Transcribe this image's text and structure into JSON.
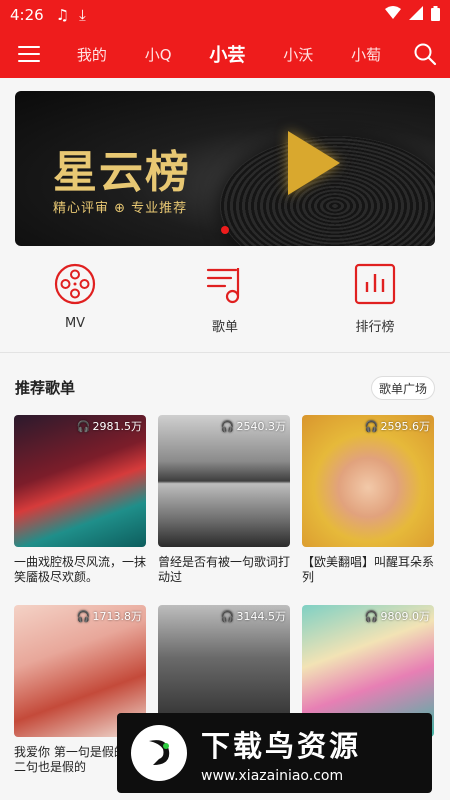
{
  "status": {
    "time": "4:26"
  },
  "nav": {
    "tabs": [
      {
        "label": "我的"
      },
      {
        "label": "小Q"
      },
      {
        "label": "小芸"
      },
      {
        "label": "小沃"
      },
      {
        "label": "小萄"
      }
    ],
    "active_tab": "小芸"
  },
  "banner": {
    "title": "星云榜",
    "subtitle": "精心评审 ⊕ 专业推荐",
    "dots": 1
  },
  "quick": [
    {
      "label": "MV",
      "icon": "film-reel-icon"
    },
    {
      "label": "歌单",
      "icon": "playlist-icon"
    },
    {
      "label": "排行榜",
      "icon": "chart-icon"
    }
  ],
  "section": {
    "title": "推荐歌单",
    "more_label": "歌单广场"
  },
  "playlists": [
    {
      "plays": "2981.5万",
      "title": "一曲戏腔极尽风流，一抹笑靥极尽欢颜。"
    },
    {
      "plays": "2540.3万",
      "title": "曾经是否有被一句歌词打动过"
    },
    {
      "plays": "2595.6万",
      "title": "【欧美翻唱】叫醒耳朵系列"
    },
    {
      "plays": "1713.8万",
      "title": "我爱你 第一句是假的 第二句也是假的"
    },
    {
      "plays": "3144.5万",
      "title": ""
    },
    {
      "plays": "9809.0万",
      "title": ""
    }
  ],
  "watermark": {
    "title": "下载鸟资源",
    "url": "www.xiazainiao.com"
  },
  "colors": {
    "brand_red": "#ee1c1c",
    "gold": "#e8c873"
  }
}
